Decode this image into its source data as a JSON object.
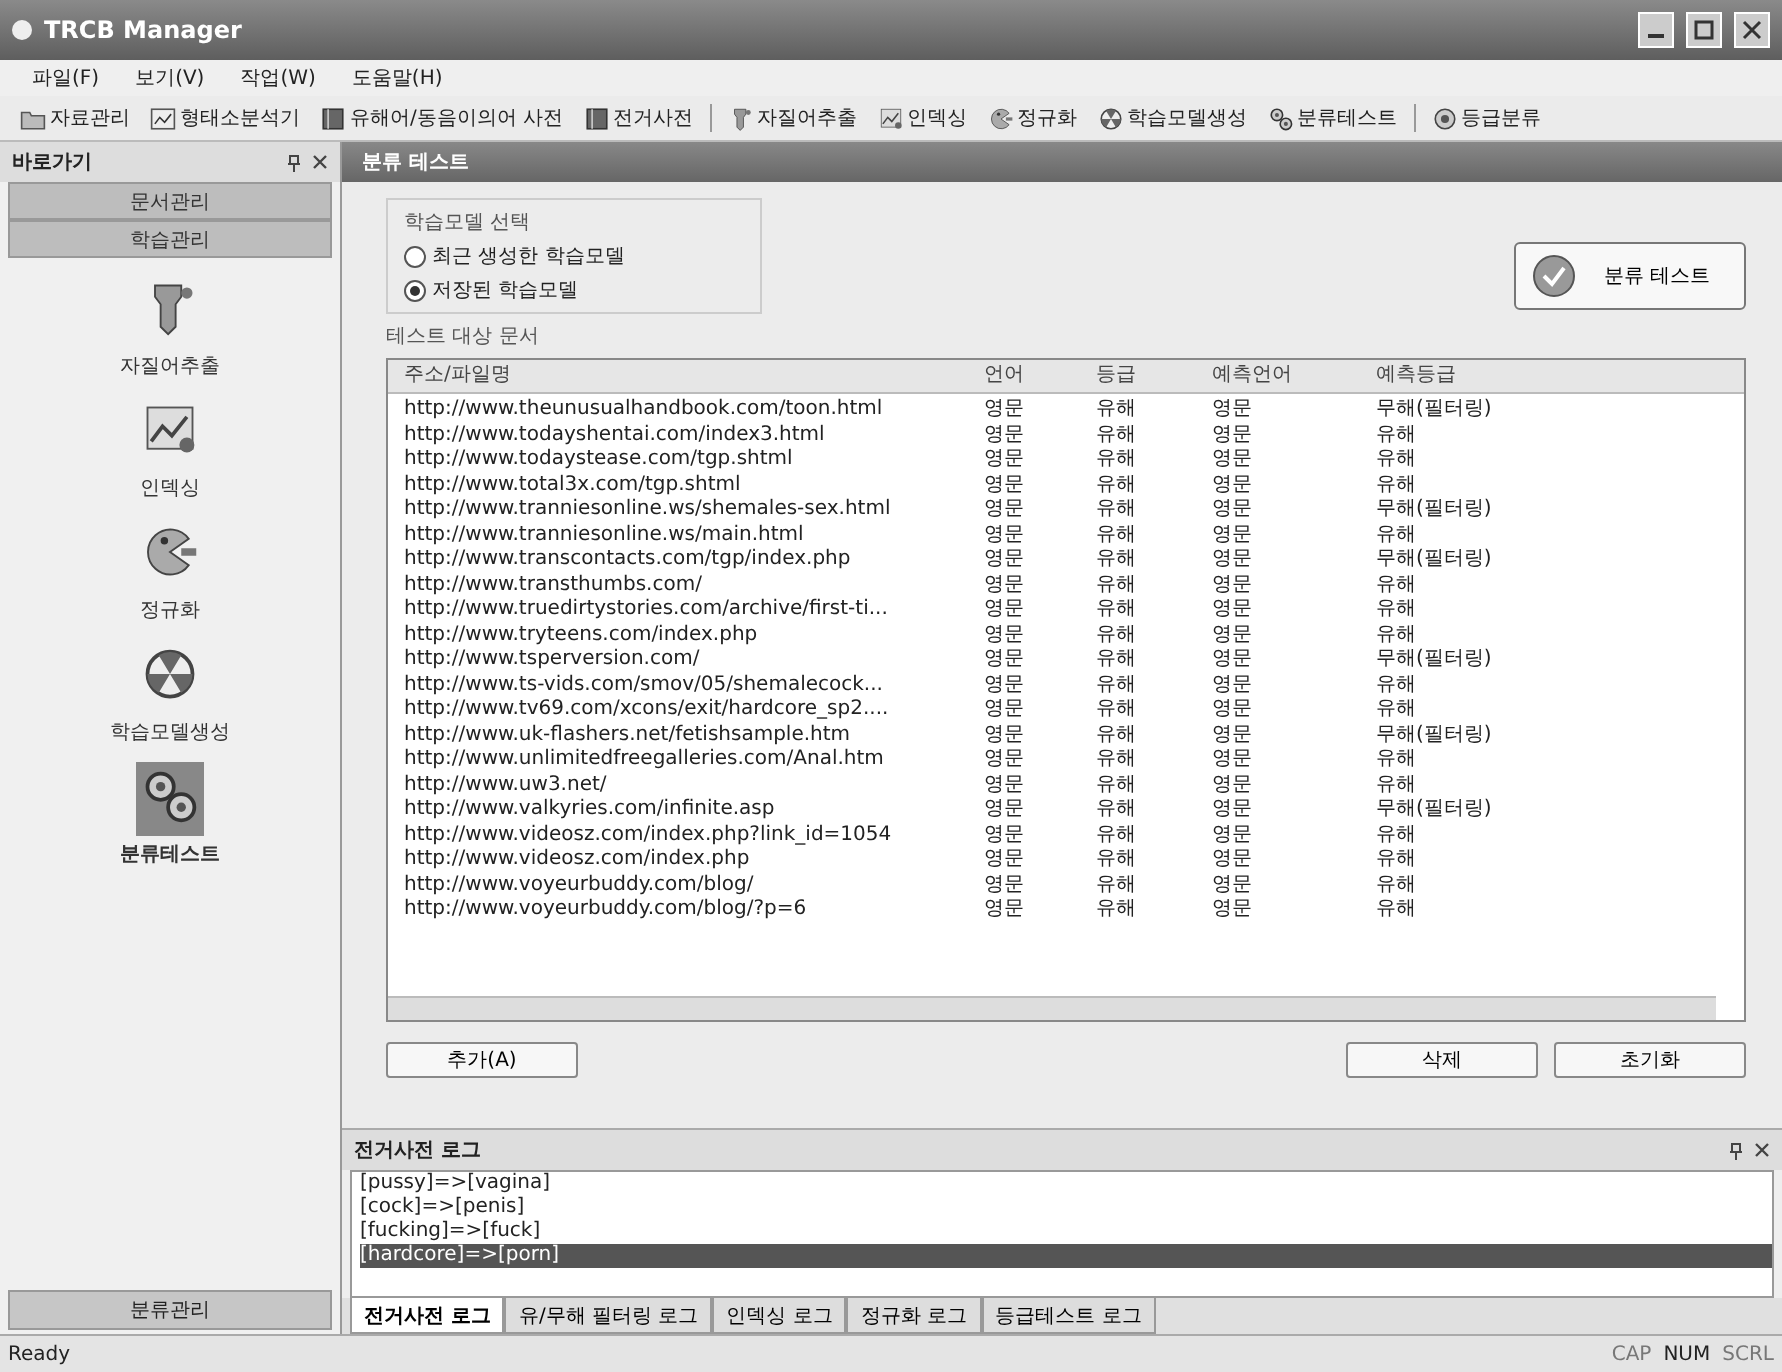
{
  "window": {
    "title": "TRCB Manager"
  },
  "menu": [
    "파일(F)",
    "보기(V)",
    "작업(W)",
    "도움말(H)"
  ],
  "toolbar": [
    {
      "label": "자료관리",
      "kind": "folder"
    },
    {
      "label": "형태소분석기",
      "kind": "chart"
    },
    {
      "label": "유해어/동음이의어 사전",
      "kind": "book"
    },
    {
      "label": "전거사전",
      "kind": "book"
    },
    {
      "label": "자질어추출",
      "kind": "extract"
    },
    {
      "label": "인덱싱",
      "kind": "index"
    },
    {
      "label": "정규화",
      "kind": "normalize"
    },
    {
      "label": "학습모델생성",
      "kind": "model"
    },
    {
      "label": "분류테스트",
      "kind": "gears"
    },
    {
      "label": "등급분류",
      "kind": "grade"
    }
  ],
  "sidebar": {
    "title": "바로가기",
    "groups": [
      "문서관리",
      "학습관리"
    ],
    "items": [
      {
        "label": "자질어추출",
        "kind": "extract",
        "selected": false
      },
      {
        "label": "인덱싱",
        "kind": "index",
        "selected": false
      },
      {
        "label": "정규화",
        "kind": "normalize",
        "selected": false
      },
      {
        "label": "학습모델생성",
        "kind": "model",
        "selected": false
      },
      {
        "label": "분류테스트",
        "kind": "gears",
        "selected": true
      }
    ],
    "bottom_group": "분류관리"
  },
  "document": {
    "title": "분류 테스트",
    "model_group": {
      "title": "학습모델 선택",
      "options": [
        {
          "label": "최근 생성한 학습모델",
          "selected": false
        },
        {
          "label": "저장된 학습모델",
          "selected": true
        }
      ]
    },
    "test_button": "분류 테스트",
    "list_title": "테스트 대상 문서",
    "table": {
      "columns": [
        "주소/파일명",
        "언어",
        "등급",
        "예측언어",
        "예측등급"
      ],
      "rows": [
        [
          "http://www.theunusualhandbook.com/toon.html",
          "영문",
          "유해",
          "영문",
          "무해(필터링)"
        ],
        [
          "http://www.todayshentai.com/index3.html",
          "영문",
          "유해",
          "영문",
          "유해"
        ],
        [
          "http://www.todaystease.com/tgp.shtml",
          "영문",
          "유해",
          "영문",
          "유해"
        ],
        [
          "http://www.total3x.com/tgp.shtml",
          "영문",
          "유해",
          "영문",
          "유해"
        ],
        [
          "http://www.tranniesonline.ws/shemales-sex.html",
          "영문",
          "유해",
          "영문",
          "무해(필터링)"
        ],
        [
          "http://www.tranniesonline.ws/main.html",
          "영문",
          "유해",
          "영문",
          "유해"
        ],
        [
          "http://www.transcontacts.com/tgp/index.php",
          "영문",
          "유해",
          "영문",
          "무해(필터링)"
        ],
        [
          "http://www.transthumbs.com/",
          "영문",
          "유해",
          "영문",
          "유해"
        ],
        [
          "http://www.truedirtystories.com/archive/first-ti...",
          "영문",
          "유해",
          "영문",
          "유해"
        ],
        [
          "http://www.tryteens.com/index.php",
          "영문",
          "유해",
          "영문",
          "유해"
        ],
        [
          "http://www.tsperversion.com/",
          "영문",
          "유해",
          "영문",
          "무해(필터링)"
        ],
        [
          "http://www.ts-vids.com/smov/05/shemalecock...",
          "영문",
          "유해",
          "영문",
          "유해"
        ],
        [
          "http://www.tv69.com/xcons/exit/hardcore_sp2....",
          "영문",
          "유해",
          "영문",
          "유해"
        ],
        [
          "http://www.uk-flashers.net/fetishsample.htm",
          "영문",
          "유해",
          "영문",
          "무해(필터링)"
        ],
        [
          "http://www.unlimitedfreegalleries.com/Anal.htm",
          "영문",
          "유해",
          "영문",
          "유해"
        ],
        [
          "http://www.uw3.net/",
          "영문",
          "유해",
          "영문",
          "유해"
        ],
        [
          "http://www.valkyries.com/infinite.asp",
          "영문",
          "유해",
          "영문",
          "무해(필터링)"
        ],
        [
          "http://www.videosz.com/index.php?link_id=1054",
          "영문",
          "유해",
          "영문",
          "유해"
        ],
        [
          "http://www.videosz.com/index.php",
          "영문",
          "유해",
          "영문",
          "유해"
        ],
        [
          "http://www.voyeurbuddy.com/blog/",
          "영문",
          "유해",
          "영문",
          "유해"
        ],
        [
          "http://www.voyeurbuddy.com/blog/?p=6",
          "영문",
          "유해",
          "영문",
          "유해"
        ]
      ]
    },
    "buttons": [
      "추가(A)",
      "삭제",
      "초기화"
    ]
  },
  "log": {
    "title": "전거사전 로그",
    "lines": [
      {
        "text": "[pussy]=>[vagina]",
        "selected": false
      },
      {
        "text": "[cock]=>[penis]",
        "selected": false
      },
      {
        "text": "[fucking]=>[fuck]",
        "selected": false
      },
      {
        "text": "[hardcore]=>[porn]",
        "selected": true
      }
    ],
    "tabs": [
      {
        "label": "전거사전 로그",
        "selected": true
      },
      {
        "label": "유/무해 필터링 로그",
        "selected": false
      },
      {
        "label": "인덱싱 로그",
        "selected": false
      },
      {
        "label": "정규화 로그",
        "selected": false
      },
      {
        "label": "등급테스트 로그",
        "selected": false
      }
    ]
  },
  "status_bar": {
    "text": "Ready",
    "indicators": [
      {
        "label": "CAP",
        "on": false
      },
      {
        "label": "NUM",
        "on": true
      },
      {
        "label": "SCRL",
        "on": false
      }
    ]
  }
}
